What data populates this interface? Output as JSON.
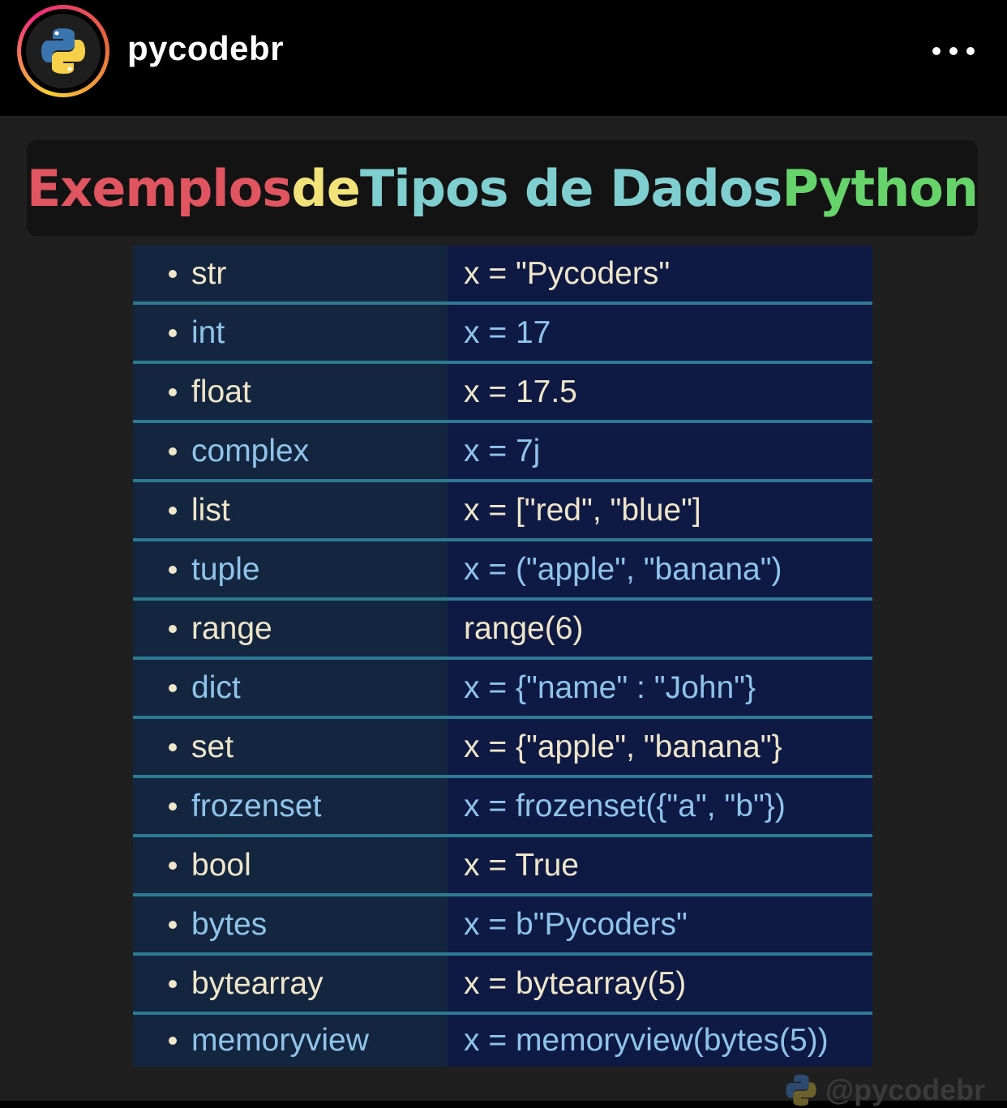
{
  "header": {
    "username": "pycodebr",
    "avatar_icon": "python-logo-icon",
    "more_icon": "more-options-icon"
  },
  "post": {
    "title": {
      "word1": "Exemplos",
      "word2": "de",
      "word3": "Tipos de Dados",
      "word4": "Python",
      "colors": [
        "#e05560",
        "#f1e27a",
        "#7fcfd0",
        "#66d46a"
      ]
    },
    "rows": [
      {
        "type": "str",
        "example": "x = \"Pycoders\"",
        "tone": "light"
      },
      {
        "type": "int",
        "example": "x = 17",
        "tone": "blue"
      },
      {
        "type": "float",
        "example": "x = 17.5",
        "tone": "light"
      },
      {
        "type": "complex",
        "example": "x = 7j",
        "tone": "blue"
      },
      {
        "type": "list",
        "example": "x = [\"red\", \"blue\"]",
        "tone": "light"
      },
      {
        "type": "tuple",
        "example": "x = (\"apple\", \"banana\")",
        "tone": "blue"
      },
      {
        "type": "range",
        "example": "range(6)",
        "tone": "light"
      },
      {
        "type": "dict",
        "example": "x = {\"name\" : \"John\"}",
        "tone": "blue"
      },
      {
        "type": "set",
        "example": "x = {\"apple\", \"banana\"}",
        "tone": "light"
      },
      {
        "type": "frozenset",
        "example": "x = frozenset({\"a\", \"b\"})",
        "tone": "blue"
      },
      {
        "type": "bool",
        "example": "x = True",
        "tone": "light"
      },
      {
        "type": "bytes",
        "example": "x = b\"Pycoders\"",
        "tone": "blue"
      },
      {
        "type": "bytearray",
        "example": "x = bytearray(5)",
        "tone": "light"
      },
      {
        "type": "memoryview",
        "example": "x = memoryview(bytes(5))",
        "tone": "blue"
      }
    ],
    "watermark": "@pycodebr"
  }
}
